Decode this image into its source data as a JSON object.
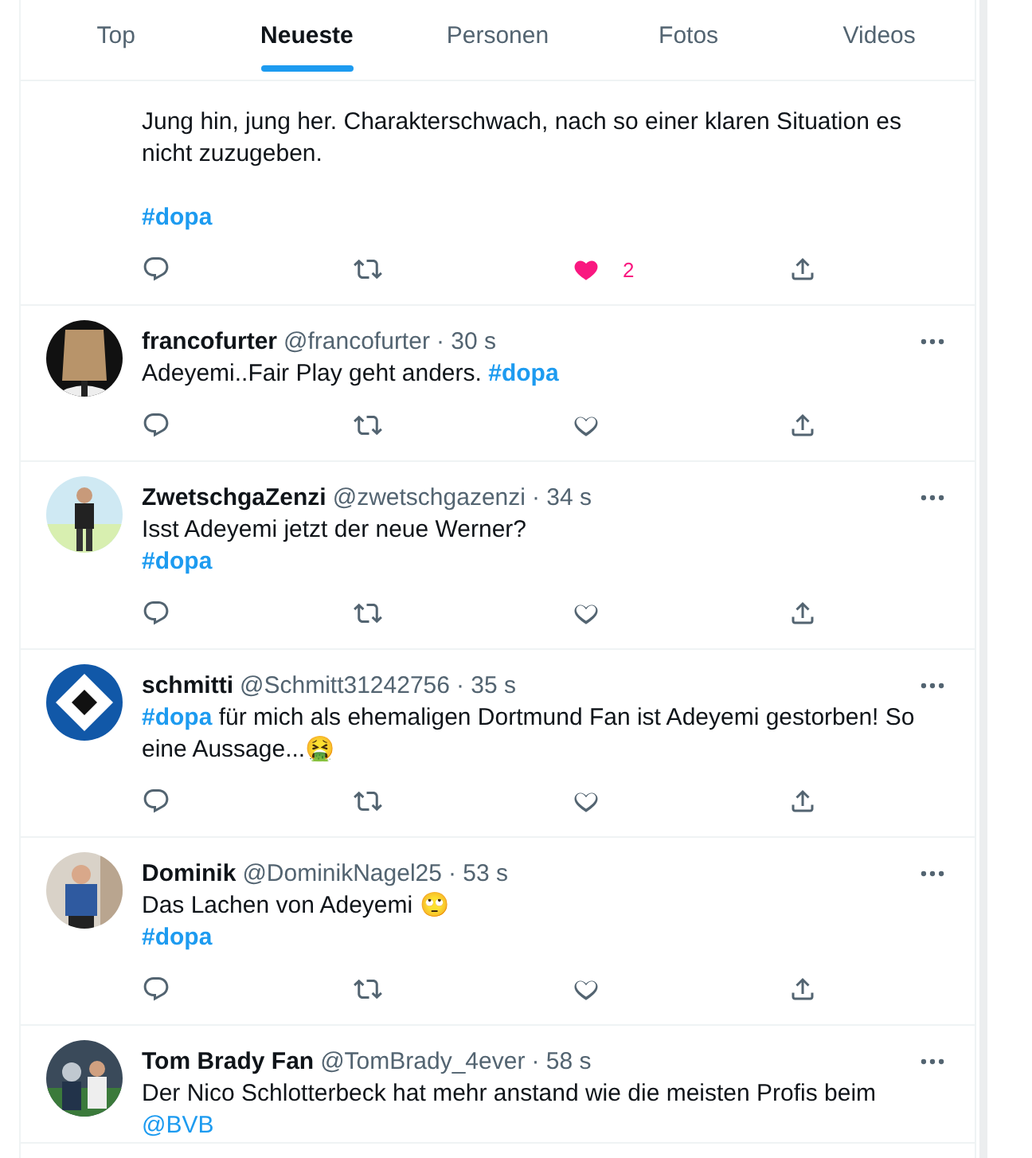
{
  "tabs": [
    {
      "label": "Top",
      "selected": false
    },
    {
      "label": "Neueste",
      "selected": true
    },
    {
      "label": "Personen",
      "selected": false
    },
    {
      "label": "Fotos",
      "selected": false
    },
    {
      "label": "Videos",
      "selected": false
    }
  ],
  "tweets": [
    {
      "text": [
        {
          "kind": "plain",
          "text": "Jung hin, jung her. Charakterschwach, nach so einer klaren Situation es nicht zuzugeben.\n\n"
        },
        {
          "kind": "hashtag",
          "text": "#dopa"
        }
      ],
      "actions": {
        "liked": true,
        "like_count": "2"
      }
    },
    {
      "name": "francofurter",
      "handle": "@francofurter",
      "time": "· 30 s",
      "text": [
        {
          "kind": "plain",
          "text": "Adeyemi..Fair Play geht anders. "
        },
        {
          "kind": "hashtag",
          "text": "#dopa"
        }
      ],
      "actions": {
        "liked": false
      }
    },
    {
      "name": "ZwetschgaZenzi",
      "handle": "@zwetschgazenzi",
      "time": "· 34 s",
      "text": [
        {
          "kind": "plain",
          "text": "Isst Adeyemi jetzt der neue Werner?\n"
        },
        {
          "kind": "hashtag",
          "text": "#dopa"
        }
      ],
      "actions": {
        "liked": false
      }
    },
    {
      "name": "schmitti",
      "handle": "@Schmitt31242756",
      "time": "· 35 s",
      "text": [
        {
          "kind": "hashtag",
          "text": "#dopa"
        },
        {
          "kind": "plain",
          "text": " für mich als ehemaligen Dortmund Fan ist Adeyemi gestorben! So eine Aussage...🤮"
        }
      ],
      "actions": {
        "liked": false
      }
    },
    {
      "name": "Dominik",
      "handle": "@DominikNagel25",
      "time": "· 53 s",
      "text": [
        {
          "kind": "plain",
          "text": "Das Lachen von Adeyemi 🙄\n"
        },
        {
          "kind": "hashtag",
          "text": "#dopa"
        }
      ],
      "actions": {
        "liked": false
      }
    },
    {
      "name": "Tom Brady Fan",
      "handle": "@TomBrady_4ever",
      "time": "· 58 s",
      "text": [
        {
          "kind": "plain",
          "text": "Der Nico Schlotterbeck hat mehr anstand wie die meisten Profis beim "
        },
        {
          "kind": "mention",
          "text": "@BVB"
        }
      ]
    }
  ]
}
